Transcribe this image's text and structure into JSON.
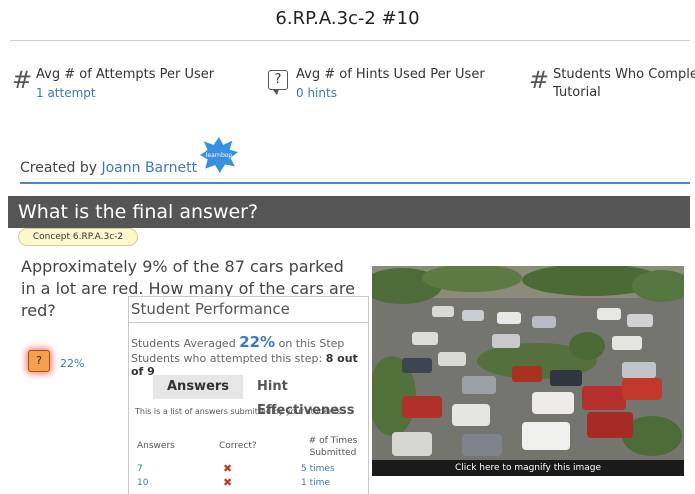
{
  "header": {
    "title": "6.RP.A.3c-2 #10"
  },
  "stats": [
    {
      "icon": "hash-icon",
      "label": "Avg # of Attempts Per User",
      "value": "1 attempt"
    },
    {
      "icon": "question-bubble-icon",
      "label": "Avg # of Hints Used Per User",
      "value": "0 hints"
    },
    {
      "icon": "hash-icon",
      "label": "Students Who Complet Tutorial",
      "value": ""
    }
  ],
  "creator": {
    "prefix": "Created by",
    "name": "Joann Barnett",
    "logo_text": "learnbop"
  },
  "question": {
    "header": "What is the final answer?",
    "concept": "Concept 6.RP.A.3c-2",
    "text": "Approximately 9% of the 87 cars parked in a lot are red.  How many of the cars are red?",
    "hint_symbol": "?",
    "hint_percent": "22%"
  },
  "performance": {
    "title": "Student Performance",
    "avg_prefix": "Students Averaged",
    "avg_value": "22%",
    "avg_suffix": "on this Step",
    "attempted_prefix": "Students who attempted this step:",
    "attempted_value": "8 out of 9",
    "tabs": [
      "Answers",
      "Hint Effectiveness"
    ],
    "description": "This is a list of answers submitted by your students.",
    "columns": [
      "Answers",
      "Correct?",
      "# of Times Submitted"
    ],
    "rows": [
      {
        "answer": "7",
        "correct": "✖",
        "times": "5 times"
      },
      {
        "answer": "10",
        "correct": "✖",
        "times": "1 time"
      }
    ]
  },
  "image": {
    "caption": "Click here to magnify this image"
  },
  "colors": {
    "link": "#3b7ab8",
    "question_bar": "#555555",
    "concept_bg": "#fbf7cf",
    "hint_bg": "#f4a24a",
    "rule": "#4a86c5"
  }
}
